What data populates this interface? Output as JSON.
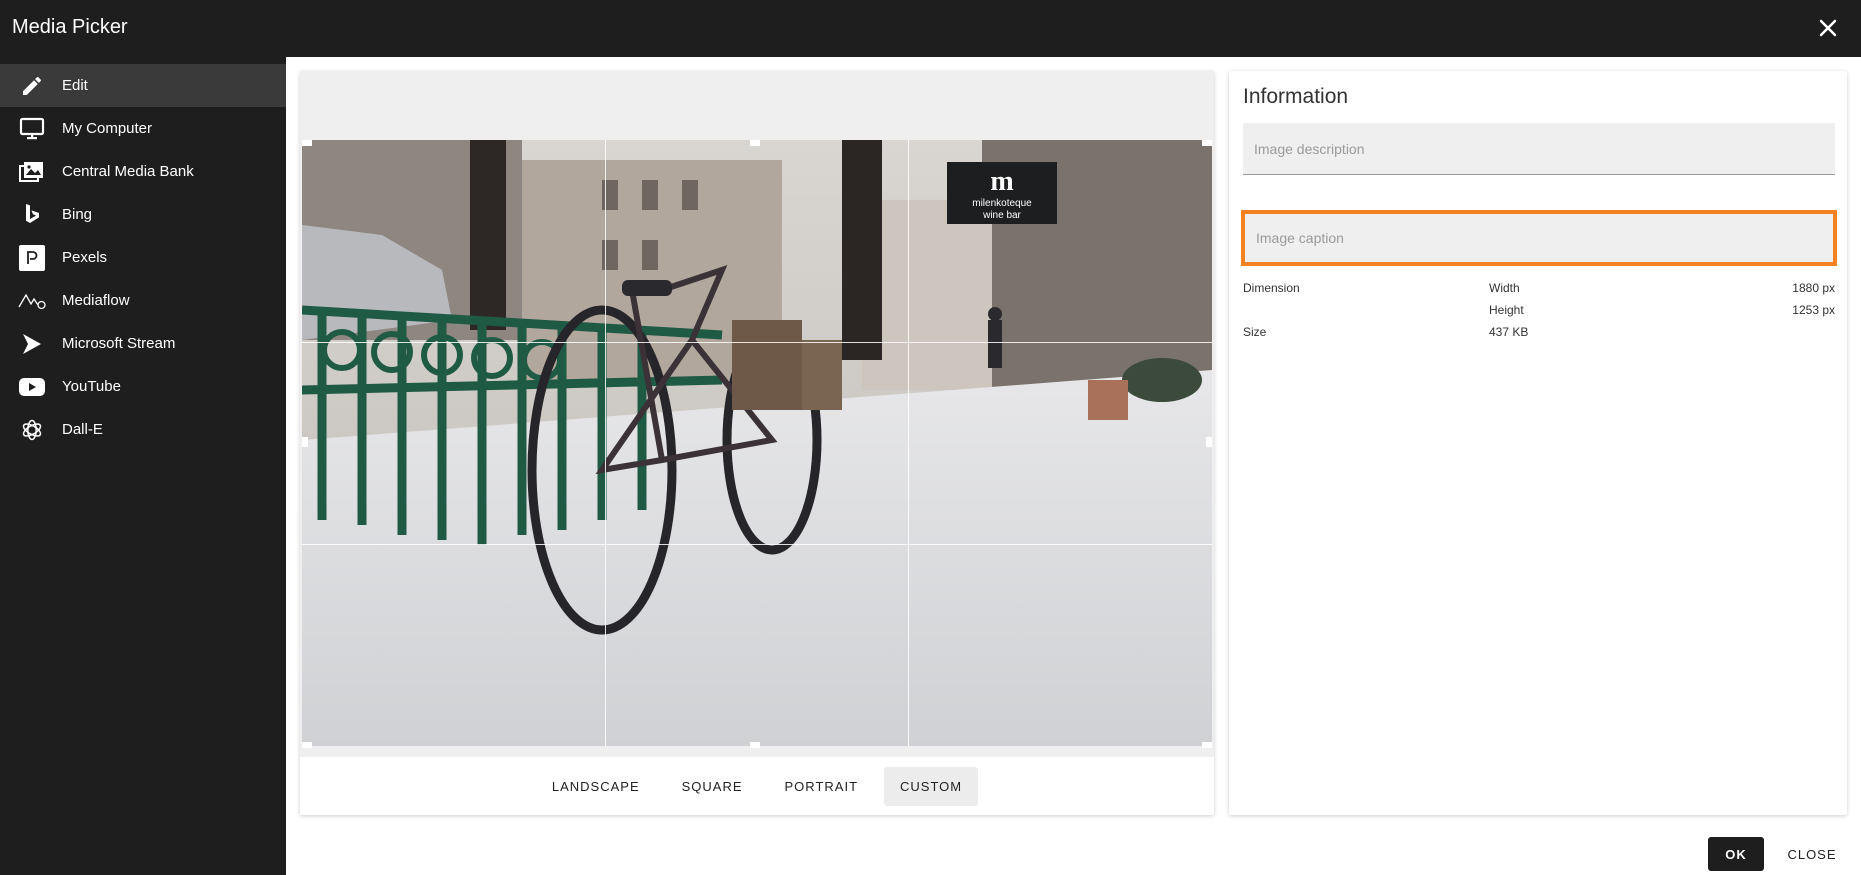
{
  "window": {
    "title": "Media Picker"
  },
  "sidebar": {
    "items": [
      {
        "label": "Edit",
        "icon": "pencil-icon",
        "active": true
      },
      {
        "label": "My Computer",
        "icon": "monitor-icon"
      },
      {
        "label": "Central Media Bank",
        "icon": "images-icon"
      },
      {
        "label": "Bing",
        "icon": "bing-icon"
      },
      {
        "label": "Pexels",
        "icon": "pexels-icon"
      },
      {
        "label": "Mediaflow",
        "icon": "mediaflow-icon"
      },
      {
        "label": "Microsoft Stream",
        "icon": "stream-icon"
      },
      {
        "label": "YouTube",
        "icon": "youtube-icon"
      },
      {
        "label": "Dall-E",
        "icon": "openai-icon"
      }
    ]
  },
  "editor": {
    "aspect_buttons": [
      "LANDSCAPE",
      "SQUARE",
      "PORTRAIT",
      "CUSTOM"
    ],
    "selected_aspect": "CUSTOM",
    "image_sign_text": [
      "milenkoteque",
      "wine bar"
    ]
  },
  "info": {
    "title": "Information",
    "description_placeholder": "Image description",
    "caption_placeholder": "Image caption",
    "dimension_label": "Dimension",
    "width_label": "Width",
    "width_value": "1880 px",
    "height_label": "Height",
    "height_value": "1253 px",
    "size_label": "Size",
    "size_value": "437 KB"
  },
  "footer": {
    "ok_label": "OK",
    "close_label": "CLOSE"
  },
  "colors": {
    "highlight": "#f58220",
    "sidebar_bg": "#1e1e1e",
    "active_item": "#3a3a3a"
  }
}
